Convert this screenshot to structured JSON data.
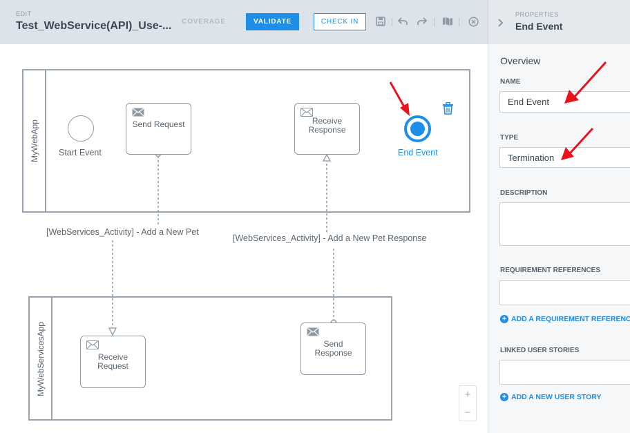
{
  "header": {
    "edit_label": "EDIT",
    "title": "Test_WebService(API)_Use-...",
    "coverage_label": "COVERAGE",
    "validate_label": "VALIDATE",
    "checkin_label": "CHECK IN",
    "icons": [
      "save-icon",
      "undo-icon",
      "redo-icon",
      "map-icon",
      "close-circle-icon"
    ]
  },
  "properties": {
    "sub_label": "PROPERTIES",
    "title": "End Event",
    "section": "Overview",
    "name_label": "NAME",
    "name_value": "End Event",
    "type_label": "TYPE",
    "type_value": "Termination",
    "description_label": "DESCRIPTION",
    "requirements_label": "REQUIREMENT REFERENCES",
    "add_requirement": "ADD A REQUIREMENT REFERENCE",
    "stories_label": "LINKED USER STORIES",
    "add_story": "ADD A NEW USER STORY"
  },
  "diagram": {
    "pool_top": "MyWebApp",
    "pool_bottom": "MyWebServicesApp",
    "start_event": "Start Event",
    "send_request": "Send Request",
    "receive_response_line1": "Receive",
    "receive_response_line2": "Response",
    "end_event": "End Event",
    "receive_request_line1": "Receive",
    "receive_request_line2": "Request",
    "send_response_line1": "Send",
    "send_response_line2": "Response",
    "flow_request": "[WebServices_Activity] - Add a New Pet",
    "flow_response": "[WebServices_Activity] - Add a New Pet Response"
  },
  "zoom": {
    "in": "+",
    "out": "−"
  },
  "colors": {
    "accent": "#1e8ee6",
    "annotation": "#e8131b"
  }
}
